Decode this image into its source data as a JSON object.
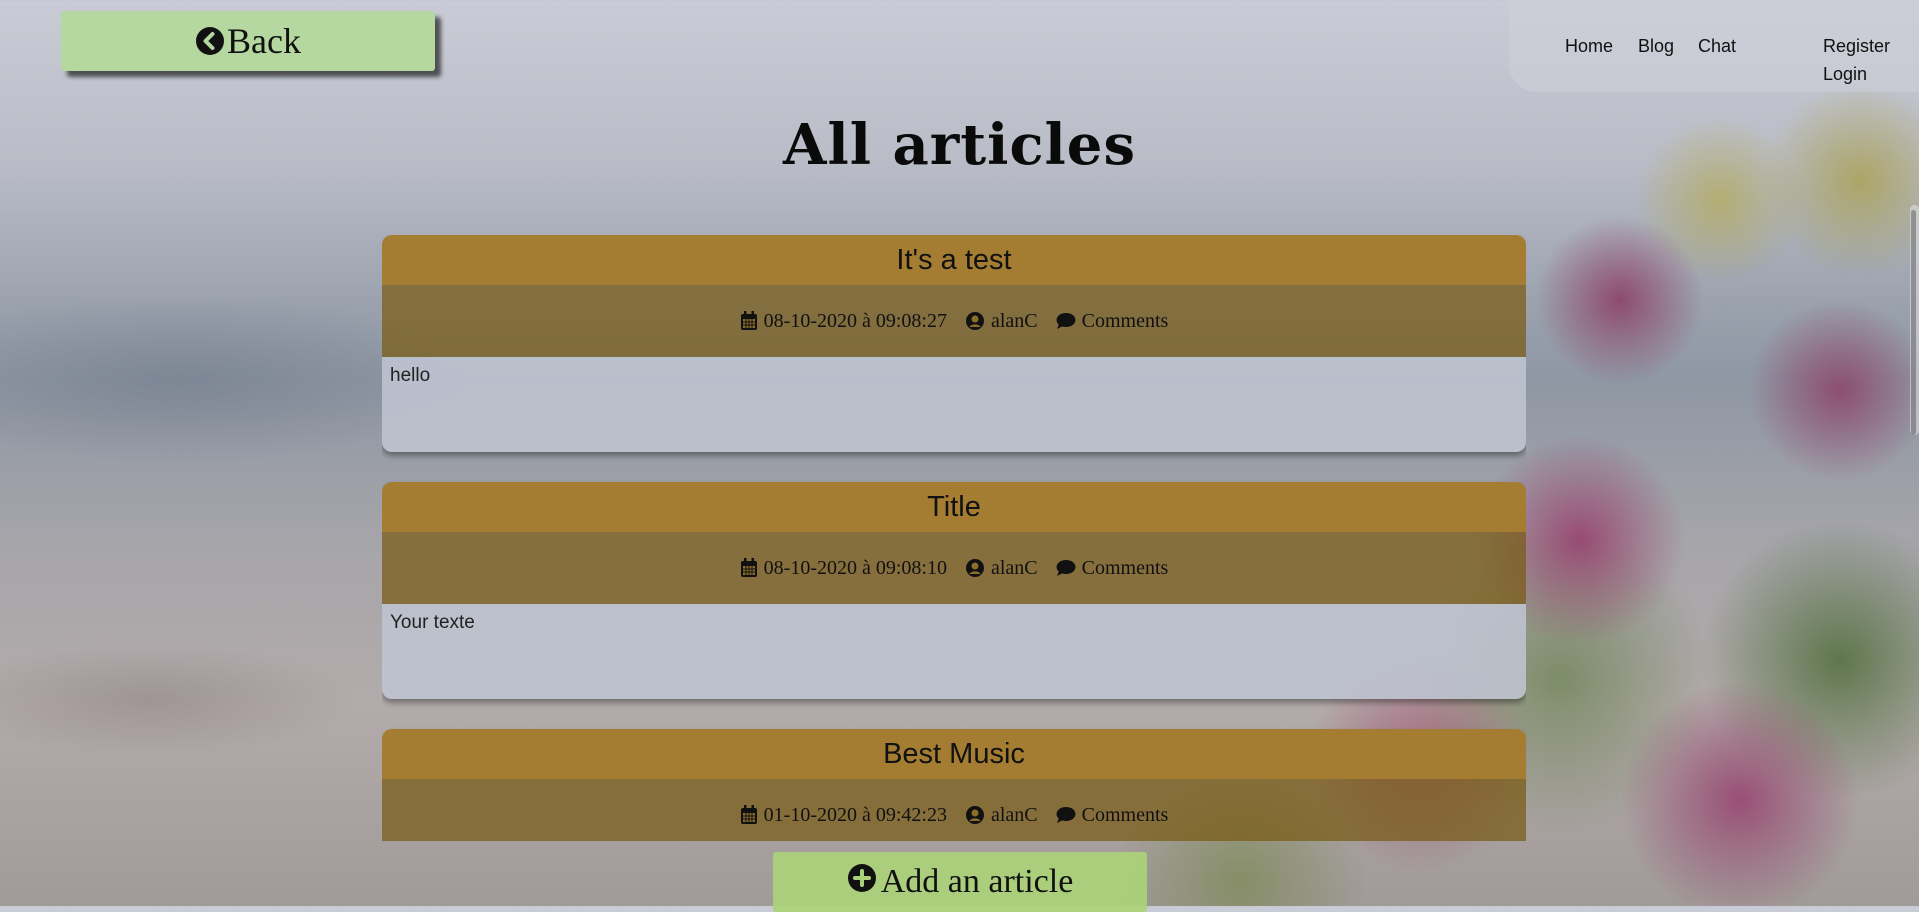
{
  "back_button": {
    "label": "Back",
    "icon": "chevron-left-circle-icon"
  },
  "nav": {
    "items": [
      {
        "label": "Home"
      },
      {
        "label": "Blog"
      },
      {
        "label": "Chat"
      },
      {
        "label": "Register"
      },
      {
        "label": "Login"
      }
    ]
  },
  "page_title": "All articles",
  "articles": [
    {
      "title": "It's a test",
      "date": "08-10-2020 à 09:08:27",
      "author": "alanC",
      "comments_label": "Comments",
      "body": "hello"
    },
    {
      "title": "Title",
      "date": "08-10-2020 à 09:08:10",
      "author": "alanC",
      "comments_label": "Comments",
      "body": "Your texte"
    },
    {
      "title": "Best Music",
      "date": "01-10-2020 à 09:42:23",
      "author": "alanC",
      "comments_label": "Comments",
      "body": ""
    }
  ],
  "add_button": {
    "label": "Add an article",
    "icon": "plus-circle-icon"
  },
  "colors": {
    "article_title_bg": "#a47d33",
    "back_button_bg": "#b4d8a0",
    "add_button_bg": "#aad278"
  }
}
